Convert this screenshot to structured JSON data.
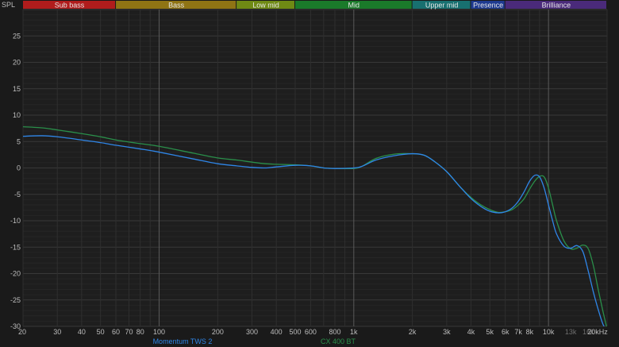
{
  "chart_data": {
    "type": "line",
    "ylabel": "SPL",
    "xscale": "log",
    "xlim": [
      20,
      20000
    ],
    "ylim": [
      -30,
      30
    ],
    "grid": true,
    "yticks": [
      25,
      20,
      15,
      10,
      5,
      0,
      -5,
      -10,
      -15,
      -20,
      -25,
      -30
    ],
    "xticks": [
      {
        "v": 20,
        "label": "20"
      },
      {
        "v": 30,
        "label": "30"
      },
      {
        "v": 40,
        "label": "40"
      },
      {
        "v": 50,
        "label": "50"
      },
      {
        "v": 60,
        "label": "60"
      },
      {
        "v": 70,
        "label": "70"
      },
      {
        "v": 80,
        "label": "80"
      },
      {
        "v": 100,
        "label": "100"
      },
      {
        "v": 200,
        "label": "200"
      },
      {
        "v": 300,
        "label": "300"
      },
      {
        "v": 400,
        "label": "400"
      },
      {
        "v": 500,
        "label": "500"
      },
      {
        "v": 600,
        "label": "600"
      },
      {
        "v": 800,
        "label": "800"
      },
      {
        "v": 1000,
        "label": "1k"
      },
      {
        "v": 2000,
        "label": "2k"
      },
      {
        "v": 3000,
        "label": "3k"
      },
      {
        "v": 4000,
        "label": "4k"
      },
      {
        "v": 5000,
        "label": "5k"
      },
      {
        "v": 6000,
        "label": "6k"
      },
      {
        "v": 7000,
        "label": "7k"
      },
      {
        "v": 8000,
        "label": "8k"
      },
      {
        "v": 10000,
        "label": "10k"
      },
      {
        "v": 13000,
        "label": "13k"
      },
      {
        "v": 16000,
        "label": "16k"
      },
      {
        "v": 20000,
        "label": "20kHz"
      }
    ],
    "bands": [
      {
        "name": "Sub bass",
        "from": 20,
        "to": 60,
        "color": "#b01c1c"
      },
      {
        "name": "Bass",
        "from": 60,
        "to": 250,
        "color": "#8f7414"
      },
      {
        "name": "Low mid",
        "from": 250,
        "to": 500,
        "color": "#6f8a14"
      },
      {
        "name": "Mid",
        "from": 500,
        "to": 2000,
        "color": "#1a7a2a"
      },
      {
        "name": "Upper mid",
        "from": 2000,
        "to": 4000,
        "color": "#187070"
      },
      {
        "name": "Presence",
        "from": 4000,
        "to": 6000,
        "color": "#1e3a90"
      },
      {
        "name": "Brilliance",
        "from": 6000,
        "to": 20000,
        "color": "#4a2a7a"
      }
    ],
    "series": [
      {
        "name": "Momentum TWS 2",
        "color": "#2f86e8",
        "x": [
          20,
          25,
          30,
          40,
          50,
          60,
          80,
          100,
          150,
          200,
          250,
          300,
          350,
          400,
          500,
          600,
          700,
          800,
          1000,
          1100,
          1300,
          1600,
          2000,
          2300,
          2600,
          3000,
          3500,
          4000,
          4500,
          5000,
          5500,
          6000,
          6500,
          7000,
          7500,
          8000,
          8500,
          9000,
          9500,
          10000,
          10500,
          11000,
          12000,
          13000,
          14000,
          15000,
          16000,
          17000,
          18000,
          19000,
          20000
        ],
        "y": [
          6.0,
          6.1,
          5.9,
          5.3,
          4.8,
          4.3,
          3.6,
          3.0,
          1.7,
          0.8,
          0.4,
          0.1,
          0.0,
          0.2,
          0.5,
          0.4,
          0.0,
          -0.1,
          0.0,
          0.3,
          1.5,
          2.3,
          2.7,
          2.4,
          1.2,
          -0.7,
          -3.5,
          -5.8,
          -7.3,
          -8.2,
          -8.5,
          -8.3,
          -7.6,
          -6.3,
          -4.5,
          -2.5,
          -1.4,
          -1.7,
          -3.8,
          -7.0,
          -10.0,
          -12.5,
          -14.8,
          -15.2,
          -14.7,
          -15.8,
          -19.5,
          -23.5,
          -26.8,
          -29.5,
          -31.0
        ]
      },
      {
        "name": "CX 400 BT",
        "color": "#2a8f4a",
        "x": [
          20,
          25,
          30,
          40,
          50,
          60,
          80,
          100,
          150,
          200,
          250,
          300,
          350,
          400,
          500,
          600,
          700,
          800,
          1000,
          1100,
          1300,
          1600,
          2000,
          2300,
          2600,
          3000,
          3500,
          4000,
          4500,
          5000,
          5500,
          6000,
          6500,
          7000,
          7500,
          8000,
          8500,
          9000,
          9500,
          10000,
          10500,
          11000,
          12000,
          13000,
          14000,
          15000,
          16000,
          17000,
          18000,
          19000,
          20000
        ],
        "y": [
          7.8,
          7.6,
          7.2,
          6.5,
          5.9,
          5.3,
          4.6,
          4.1,
          2.8,
          1.9,
          1.5,
          1.1,
          0.8,
          0.7,
          0.6,
          0.4,
          0.0,
          -0.1,
          -0.1,
          0.3,
          1.8,
          2.6,
          2.7,
          2.4,
          1.2,
          -0.7,
          -3.5,
          -5.6,
          -7.0,
          -7.9,
          -8.4,
          -8.3,
          -7.9,
          -7.0,
          -5.8,
          -4.0,
          -2.5,
          -1.6,
          -1.7,
          -3.8,
          -7.0,
          -10.0,
          -13.8,
          -15.3,
          -15.2,
          -14.6,
          -15.3,
          -18.5,
          -23.0,
          -27.0,
          -30.5
        ]
      }
    ]
  }
}
